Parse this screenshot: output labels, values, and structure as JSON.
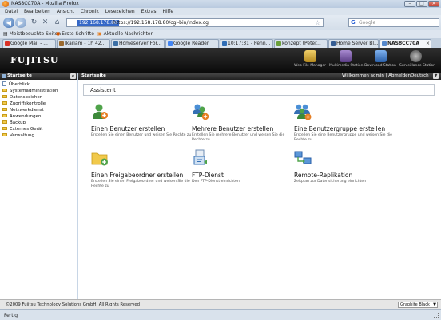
{
  "window": {
    "title": "NAS8CC70A - Mozilla Firefox",
    "controls": {
      "minimize": "–",
      "maximize": "□",
      "close": "×"
    }
  },
  "menubar": [
    "Datei",
    "Bearbeiten",
    "Ansicht",
    "Chronik",
    "Lesezeichen",
    "Extras",
    "Hilfe"
  ],
  "navbar": {
    "url_highlight": "192.168.178.80",
    "url": "https://192.168.178.80/cgi-bin/index.cgi",
    "search_placeholder": "Google",
    "search_engine_glyph": "G"
  },
  "bookmarks": [
    "Meistbesuchte Seiten",
    "Erste Schritte",
    "Aktuelle Nachrichten"
  ],
  "tabs": [
    {
      "label": "Google Mail - ...",
      "color": "#d93025"
    },
    {
      "label": "Ikariam - 1h 42...",
      "color": "#9b6a2f"
    },
    {
      "label": "Homeserver For...",
      "color": "#3a6ea5"
    },
    {
      "label": "Google Reader",
      "color": "#4285f4"
    },
    {
      "label": "10:17:31 - Penn...",
      "color": "#2f6db5"
    },
    {
      "label": "konzept (Peter...",
      "color": "#6a9f3a"
    },
    {
      "label": "Home Server Bl...",
      "color": "#355d94"
    },
    {
      "label": "NAS8CC70A",
      "color": "#5588cc"
    }
  ],
  "app": {
    "logo": "FUJITSU",
    "header_icons": [
      {
        "label": "Web File Manager",
        "color": "#d4a93c"
      },
      {
        "label": "Multimedia Station",
        "color": "#7b5aa6"
      },
      {
        "label": "Download Station",
        "color": "#3f7fcf"
      },
      {
        "label": "Surveillance Station",
        "color": "#777777"
      }
    ]
  },
  "sidebar": {
    "title": "Startseite",
    "items": [
      {
        "label": "Überblick",
        "type": "page"
      },
      {
        "label": "Systemadministration",
        "type": "folder"
      },
      {
        "label": "Datenspeicher",
        "type": "folder"
      },
      {
        "label": "Zugriffskontrolle",
        "type": "folder"
      },
      {
        "label": "Netzwerkdienst",
        "type": "folder"
      },
      {
        "label": "Anwendungen",
        "type": "folder"
      },
      {
        "label": "Backup",
        "type": "folder"
      },
      {
        "label": "Externes Gerät",
        "type": "folder"
      },
      {
        "label": "Verwaltung",
        "type": "folder"
      }
    ]
  },
  "content": {
    "title": "Startseite",
    "user_text": "Willkommen admin | Abmelden",
    "language": "Deutsch",
    "assistant_label": "Assistent",
    "tasks": [
      {
        "name": "Einen Benutzer erstellen",
        "desc": "Erstellen Sie einen Benutzer und weisen Sie Rechte zu",
        "icon": "user-add-icon"
      },
      {
        "name": "Mehrere Benutzer erstellen",
        "desc": "Erstellen Sie mehrere Benutzer und weisen Sie die Rechte zu",
        "icon": "users-add-icon"
      },
      {
        "name": "Eine Benutzergruppe erstellen",
        "desc": "Erstellen Sie eine Benutzergruppe und weisen Sie die Rechte zu",
        "icon": "group-add-icon"
      },
      {
        "name": "Einen Freigabeordner erstellen",
        "desc": "Erstellen Sie einen Freigabeordner und weisen Sie die Rechte zu",
        "icon": "folder-add-icon"
      },
      {
        "name": "FTP-Dienst",
        "desc": "Den FTP-Dienst einrichten",
        "icon": "ftp-icon"
      },
      {
        "name": "Remote-Replikation",
        "desc": "Zeitplan zur Datensicherung einrichten",
        "icon": "replication-icon"
      }
    ]
  },
  "footer": {
    "copyright": "©2009 Fujitsu Technology Solutions GmbH, All Rights Reserved",
    "theme": "Graphite Black"
  },
  "statusbar": {
    "text": "Fertig"
  }
}
